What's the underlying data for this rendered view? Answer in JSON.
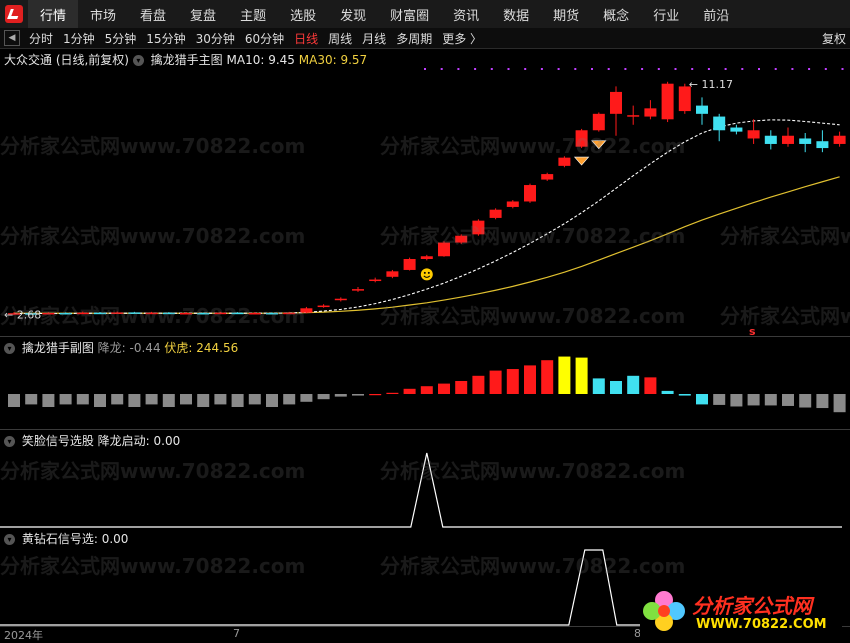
{
  "menu": {
    "items": [
      "行情",
      "市场",
      "看盘",
      "复盘",
      "主题",
      "选股",
      "发现",
      "财富圈",
      "资讯",
      "数据",
      "期货",
      "概念",
      "行业",
      "前沿"
    ],
    "active_index": 0
  },
  "periods": {
    "items": [
      "分时",
      "1分钟",
      "5分钟",
      "15分钟",
      "30分钟",
      "60分钟",
      "日线",
      "周线",
      "月线",
      "多周期",
      "更多 〉"
    ],
    "active_index": 6,
    "restore_label": "复权"
  },
  "main_panel": {
    "stock": "大众交通 (日线,前复权)",
    "indicator": "擒龙猎手主图",
    "ma10": "MA10: 9.45",
    "ma30": "MA30: 9.57",
    "high_label": "11.17",
    "low_label": "2.68",
    "marker": "s"
  },
  "sub_panel": {
    "title": "擒龙猎手副图",
    "jianglong": "降龙: -0.44",
    "fuhu": "伏虎: 244.56"
  },
  "smile_panel": {
    "title": "笑脸信号选股",
    "value": "降龙启动: 0.00"
  },
  "diamond_panel": {
    "title": "黄钻石信号选",
    "value": ": 0.00"
  },
  "xaxis": {
    "labels": [
      "2024年",
      "7",
      "8"
    ]
  },
  "watermark": {
    "text": "分析家公式网www.70822.com"
  },
  "brand": {
    "name": "分析家公式网",
    "url": "WWW.70822.COM"
  },
  "colors": {
    "up": "#ff1a1a",
    "down": "#40e0f0",
    "ma30": "#e0c030",
    "ma10": "#ffffff",
    "sub_gray": "#8a8a8a",
    "sub_yellow": "#ffff00"
  },
  "chart_data": {
    "type": "candlestick",
    "candles": [
      {
        "o": 2.7,
        "c": 2.72,
        "h": 2.76,
        "l": 2.66
      },
      {
        "o": 2.72,
        "c": 2.7,
        "h": 2.75,
        "l": 2.67
      },
      {
        "o": 2.7,
        "c": 2.73,
        "h": 2.76,
        "l": 2.68
      },
      {
        "o": 2.73,
        "c": 2.71,
        "h": 2.75,
        "l": 2.68
      },
      {
        "o": 2.71,
        "c": 2.74,
        "h": 2.78,
        "l": 2.69
      },
      {
        "o": 2.74,
        "c": 2.72,
        "h": 2.76,
        "l": 2.69
      },
      {
        "o": 2.72,
        "c": 2.75,
        "h": 2.78,
        "l": 2.7
      },
      {
        "o": 2.75,
        "c": 2.73,
        "h": 2.77,
        "l": 2.7
      },
      {
        "o": 2.73,
        "c": 2.74,
        "h": 2.77,
        "l": 2.71
      },
      {
        "o": 2.74,
        "c": 2.72,
        "h": 2.76,
        "l": 2.7
      },
      {
        "o": 2.72,
        "c": 2.73,
        "h": 2.76,
        "l": 2.7
      },
      {
        "o": 2.73,
        "c": 2.71,
        "h": 2.75,
        "l": 2.69
      },
      {
        "o": 2.71,
        "c": 2.74,
        "h": 2.77,
        "l": 2.69
      },
      {
        "o": 2.74,
        "c": 2.72,
        "h": 2.76,
        "l": 2.7
      },
      {
        "o": 2.72,
        "c": 2.73,
        "h": 2.76,
        "l": 2.7
      },
      {
        "o": 2.73,
        "c": 2.72,
        "h": 2.75,
        "l": 2.7
      },
      {
        "o": 2.72,
        "c": 2.74,
        "h": 2.77,
        "l": 2.7
      },
      {
        "o": 2.74,
        "c": 2.9,
        "h": 2.95,
        "l": 2.72
      },
      {
        "o": 2.95,
        "c": 3.0,
        "h": 3.05,
        "l": 2.92
      },
      {
        "o": 3.2,
        "c": 3.25,
        "h": 3.3,
        "l": 3.15
      },
      {
        "o": 3.55,
        "c": 3.6,
        "h": 3.68,
        "l": 3.5
      },
      {
        "o": 3.9,
        "c": 3.95,
        "h": 4.02,
        "l": 3.85
      },
      {
        "o": 4.05,
        "c": 4.25,
        "h": 4.3,
        "l": 4.0
      },
      {
        "o": 4.3,
        "c": 4.7,
        "h": 4.75,
        "l": 4.28
      },
      {
        "o": 4.7,
        "c": 4.8,
        "h": 4.85,
        "l": 4.65
      },
      {
        "o": 4.8,
        "c": 5.3,
        "h": 5.35,
        "l": 4.78
      },
      {
        "o": 5.3,
        "c": 5.55,
        "h": 5.6,
        "l": 5.25
      },
      {
        "o": 5.6,
        "c": 6.1,
        "h": 6.15,
        "l": 5.55
      },
      {
        "o": 6.2,
        "c": 6.5,
        "h": 6.55,
        "l": 6.15
      },
      {
        "o": 6.6,
        "c": 6.8,
        "h": 6.85,
        "l": 6.55
      },
      {
        "o": 6.8,
        "c": 7.4,
        "h": 7.45,
        "l": 6.75
      },
      {
        "o": 7.6,
        "c": 7.8,
        "h": 7.85,
        "l": 7.55
      },
      {
        "o": 8.1,
        "c": 8.4,
        "h": 8.45,
        "l": 8.05
      },
      {
        "o": 8.8,
        "c": 9.4,
        "h": 9.45,
        "l": 8.75
      },
      {
        "o": 9.4,
        "c": 10.0,
        "h": 10.05,
        "l": 9.35
      },
      {
        "o": 10.0,
        "c": 10.8,
        "h": 11.0,
        "l": 9.2
      },
      {
        "o": 9.9,
        "c": 9.95,
        "h": 10.3,
        "l": 9.6
      },
      {
        "o": 9.9,
        "c": 10.2,
        "h": 10.5,
        "l": 9.8
      },
      {
        "o": 9.8,
        "c": 11.1,
        "h": 11.17,
        "l": 9.7
      },
      {
        "o": 10.1,
        "c": 11.0,
        "h": 11.1,
        "l": 10.0
      },
      {
        "o": 10.3,
        "c": 10.0,
        "h": 10.6,
        "l": 9.6
      },
      {
        "o": 9.9,
        "c": 9.4,
        "h": 10.0,
        "l": 9.0
      },
      {
        "o": 9.5,
        "c": 9.35,
        "h": 9.6,
        "l": 9.25
      },
      {
        "o": 9.1,
        "c": 9.4,
        "h": 9.8,
        "l": 8.9
      },
      {
        "o": 9.2,
        "c": 8.9,
        "h": 9.4,
        "l": 8.7
      },
      {
        "o": 8.9,
        "c": 9.2,
        "h": 9.5,
        "l": 8.8
      },
      {
        "o": 9.1,
        "c": 8.9,
        "h": 9.3,
        "l": 8.6
      },
      {
        "o": 9.0,
        "c": 8.75,
        "h": 9.4,
        "l": 8.6
      },
      {
        "o": 8.9,
        "c": 9.2,
        "h": 9.35,
        "l": 8.8
      }
    ],
    "ma30": [
      2.72,
      2.72,
      2.72,
      2.72,
      2.72,
      2.72,
      2.72,
      2.72,
      2.72,
      2.72,
      2.72,
      2.72,
      2.72,
      2.72,
      2.72,
      2.72,
      2.73,
      2.74,
      2.76,
      2.79,
      2.83,
      2.88,
      2.94,
      3.02,
      3.1,
      3.2,
      3.31,
      3.43,
      3.56,
      3.7,
      3.86,
      4.03,
      4.22,
      4.43,
      4.66,
      4.9,
      5.13,
      5.37,
      5.62,
      5.88,
      6.12,
      6.34,
      6.55,
      6.76,
      6.96,
      7.15,
      7.34,
      7.52,
      7.7
    ],
    "ma10": [
      2.71,
      2.71,
      2.71,
      2.71,
      2.72,
      2.72,
      2.72,
      2.72,
      2.72,
      2.72,
      2.72,
      2.72,
      2.72,
      2.72,
      2.72,
      2.72,
      2.73,
      2.75,
      2.8,
      2.86,
      2.95,
      3.07,
      3.22,
      3.4,
      3.6,
      3.82,
      4.07,
      4.34,
      4.63,
      4.94,
      5.27,
      5.62,
      5.99,
      6.39,
      6.82,
      7.28,
      7.74,
      8.18,
      8.6,
      8.98,
      9.3,
      9.52,
      9.66,
      9.74,
      9.78,
      9.77,
      9.72,
      9.66,
      9.6
    ],
    "ylim": [
      2.4,
      11.6
    ],
    "sub_values": [
      -2.5,
      -2,
      -2.5,
      -2,
      -2,
      -2.5,
      -2,
      -2.5,
      -2,
      -2.5,
      -2,
      -2.5,
      -2,
      -2.5,
      -2,
      -2.5,
      -2,
      -1.5,
      -1,
      -0.5,
      -0.3,
      -0.2,
      0.2,
      1,
      1.5,
      2,
      2.5,
      3.5,
      4.5,
      4.8,
      5.5,
      6.5,
      7.2,
      7.0,
      3.0,
      2.5,
      3.5,
      3.2,
      0.6,
      -0.3,
      -2.0,
      -2.1,
      -2.4,
      -2.2,
      -2.2,
      -2.3,
      -2.6,
      -2.7,
      -3.5
    ],
    "sub_colors": [
      "g",
      "g",
      "g",
      "g",
      "g",
      "g",
      "g",
      "g",
      "g",
      "g",
      "g",
      "g",
      "g",
      "g",
      "g",
      "g",
      "g",
      "g",
      "g",
      "g",
      "g",
      "r",
      "r",
      "r",
      "r",
      "r",
      "r",
      "r",
      "r",
      "r",
      "r",
      "r",
      "y",
      "y",
      "c",
      "c",
      "c",
      "r",
      "c",
      "c",
      "c",
      "g",
      "g",
      "g",
      "g",
      "g",
      "g",
      "g",
      "g"
    ],
    "smile_signal_index": 24,
    "diamond_signal_index": 34
  }
}
